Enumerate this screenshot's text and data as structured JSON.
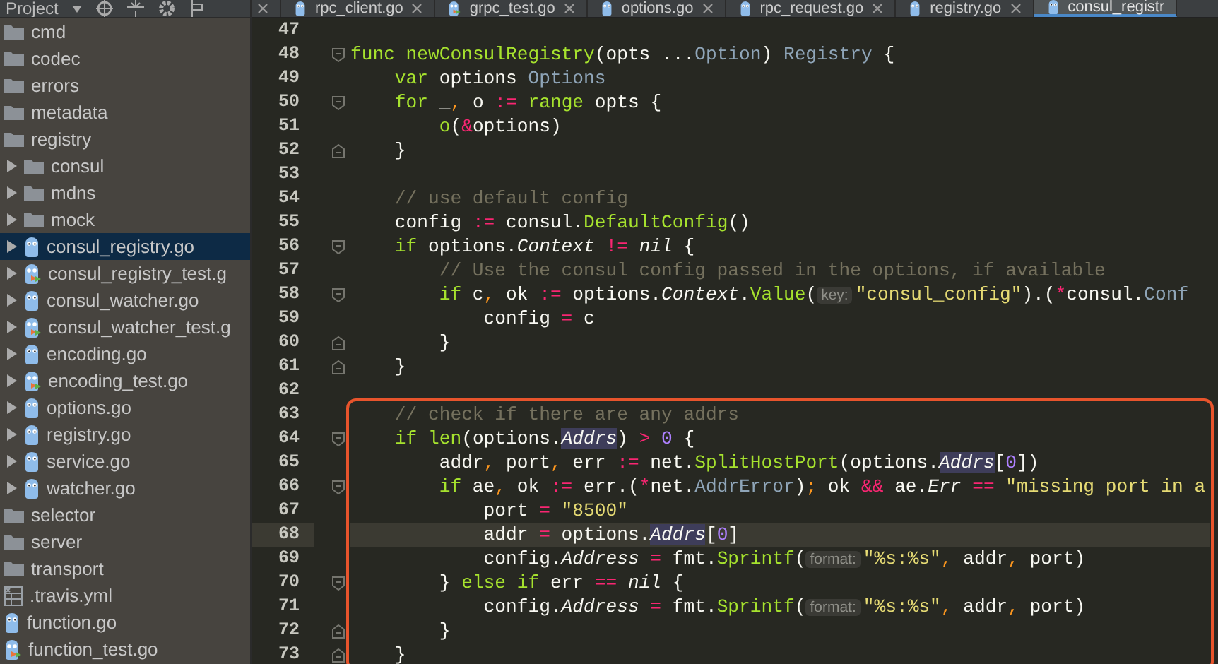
{
  "project_panel": {
    "title": "Project",
    "tree": [
      {
        "label": "cmd",
        "kind": "folder",
        "selected": false
      },
      {
        "label": "codec",
        "kind": "folder",
        "selected": false
      },
      {
        "label": "errors",
        "kind": "folder",
        "selected": false
      },
      {
        "label": "metadata",
        "kind": "folder",
        "selected": false
      },
      {
        "label": "registry",
        "kind": "folder",
        "selected": false,
        "children": [
          {
            "label": "consul",
            "kind": "folder",
            "selected": false,
            "expanded": false
          },
          {
            "label": "mdns",
            "kind": "folder",
            "selected": false,
            "expanded": false
          },
          {
            "label": "mock",
            "kind": "folder",
            "selected": false,
            "expanded": false
          },
          {
            "label": "consul_registry.go",
            "kind": "go",
            "selected": true,
            "expanded": false
          },
          {
            "label": "consul_registry_test.g",
            "kind": "gotest",
            "selected": false,
            "expanded": false
          },
          {
            "label": "consul_watcher.go",
            "kind": "go",
            "selected": false,
            "expanded": false
          },
          {
            "label": "consul_watcher_test.g",
            "kind": "gotest",
            "selected": false,
            "expanded": false
          },
          {
            "label": "encoding.go",
            "kind": "go",
            "selected": false,
            "expanded": false
          },
          {
            "label": "encoding_test.go",
            "kind": "gotest",
            "selected": false,
            "expanded": false
          },
          {
            "label": "options.go",
            "kind": "go",
            "selected": false,
            "expanded": false
          },
          {
            "label": "registry.go",
            "kind": "go",
            "selected": false,
            "expanded": false
          },
          {
            "label": "service.go",
            "kind": "go",
            "selected": false,
            "expanded": false
          },
          {
            "label": "watcher.go",
            "kind": "go",
            "selected": false,
            "expanded": false
          }
        ]
      },
      {
        "label": "selector",
        "kind": "folder",
        "selected": false
      },
      {
        "label": "server",
        "kind": "folder",
        "selected": false
      },
      {
        "label": "transport",
        "kind": "folder",
        "selected": false
      },
      {
        "label": ".travis.yml",
        "kind": "yaml",
        "selected": false
      },
      {
        "label": "function.go",
        "kind": "go",
        "selected": false
      },
      {
        "label": "function_test.go",
        "kind": "gotest",
        "selected": false
      }
    ]
  },
  "tabs": [
    {
      "label": "rpc_client.go",
      "kind": "go",
      "selected": false
    },
    {
      "label": "grpc_test.go",
      "kind": "gotest",
      "selected": false
    },
    {
      "label": "options.go",
      "kind": "go",
      "selected": false
    },
    {
      "label": "rpc_request.go",
      "kind": "go",
      "selected": false
    },
    {
      "label": "registry.go",
      "kind": "go",
      "selected": false
    },
    {
      "label": "consul_registr",
      "kind": "go",
      "selected": true
    }
  ],
  "code": {
    "lines": [
      {
        "number": "47",
        "current": false,
        "fold_start": false,
        "fold_end": false
      },
      {
        "number": "48",
        "current": false,
        "boxed": false,
        "fold_start": true,
        "fold_end": false,
        "tokens": [
          {
            "kind": "kw",
            "text": "func "
          },
          {
            "kind": "fn",
            "text": "newConsulRegistry"
          },
          {
            "kind": "plain",
            "text": "(opts ..."
          },
          {
            "kind": "type",
            "text": "Option"
          },
          {
            "kind": "plain",
            "text": ") "
          },
          {
            "kind": "type",
            "text": "Registry"
          },
          {
            "kind": "plain",
            "text": " {"
          }
        ]
      },
      {
        "number": "49",
        "current": false,
        "boxed": false,
        "fold_start": false,
        "fold_end": false,
        "tokens": [
          {
            "kind": "kw",
            "text": "    var"
          },
          {
            "kind": "plain",
            "text": " options "
          },
          {
            "kind": "type",
            "text": "Options"
          }
        ]
      },
      {
        "number": "50",
        "current": false,
        "boxed": false,
        "fold_start": true,
        "fold_end": false,
        "tokens": [
          {
            "kind": "kw",
            "text": "    for"
          },
          {
            "kind": "plain",
            "text": " _"
          },
          {
            "kind": "punc",
            "text": ","
          },
          {
            "kind": "plain",
            "text": " o "
          },
          {
            "kind": "op",
            "text": ":="
          },
          {
            "kind": "kw",
            "text": " range"
          },
          {
            "kind": "plain",
            "text": " opts {"
          }
        ]
      },
      {
        "number": "51",
        "current": false,
        "boxed": false,
        "fold_start": false,
        "fold_end": false,
        "tokens": [
          {
            "kind": "fn",
            "text": "        o"
          },
          {
            "kind": "plain",
            "text": "("
          },
          {
            "kind": "op",
            "text": "&"
          },
          {
            "kind": "plain",
            "text": "options)"
          }
        ]
      },
      {
        "number": "52",
        "current": false,
        "boxed": false,
        "fold_start": false,
        "fold_end": true,
        "tokens": [
          {
            "kind": "plain",
            "text": "    }"
          }
        ]
      },
      {
        "number": "53",
        "current": false,
        "fold_start": false,
        "fold_end": false
      },
      {
        "number": "54",
        "current": false,
        "boxed": false,
        "fold_start": false,
        "fold_end": false,
        "tokens": [
          {
            "kind": "cmt",
            "text": "    // use default config"
          }
        ]
      },
      {
        "number": "55",
        "current": false,
        "boxed": false,
        "fold_start": false,
        "fold_end": false,
        "tokens": [
          {
            "kind": "plain",
            "text": "    config "
          },
          {
            "kind": "op",
            "text": ":="
          },
          {
            "kind": "plain",
            "text": " consul."
          },
          {
            "kind": "fn",
            "text": "DefaultConfig"
          },
          {
            "kind": "plain",
            "text": "()"
          }
        ]
      },
      {
        "number": "56",
        "current": false,
        "boxed": false,
        "fold_start": true,
        "fold_end": false,
        "tokens": [
          {
            "kind": "kw",
            "text": "    if"
          },
          {
            "kind": "plain",
            "text": " options."
          },
          {
            "kind": "field",
            "text": "Context"
          },
          {
            "kind": "op",
            "text": " !="
          },
          {
            "kind": "field",
            "text": " nil"
          },
          {
            "kind": "plain",
            "text": " {"
          }
        ]
      },
      {
        "number": "57",
        "current": false,
        "boxed": false,
        "fold_start": false,
        "fold_end": false,
        "tokens": [
          {
            "kind": "cmt",
            "text": "        // Use the consul config passed in the options, if available"
          }
        ]
      },
      {
        "number": "58",
        "current": false,
        "boxed": false,
        "fold_start": true,
        "fold_end": false,
        "tokens": [
          {
            "kind": "kw",
            "text": "        if"
          },
          {
            "kind": "plain",
            "text": " c"
          },
          {
            "kind": "punc",
            "text": ","
          },
          {
            "kind": "plain",
            "text": " ok "
          },
          {
            "kind": "op",
            "text": ":="
          },
          {
            "kind": "plain",
            "text": " options."
          },
          {
            "kind": "field",
            "text": "Context"
          },
          {
            "kind": "plain",
            "text": "."
          },
          {
            "kind": "fn",
            "text": "Value"
          },
          {
            "kind": "plain",
            "text": "("
          },
          {
            "kind": "hint",
            "text": "key:"
          },
          {
            "kind": "str",
            "text": "\"consul_config\""
          },
          {
            "kind": "plain",
            "text": ").("
          },
          {
            "kind": "op",
            "text": "*"
          },
          {
            "kind": "plain",
            "text": "consul."
          },
          {
            "kind": "type",
            "text": "Conf"
          }
        ]
      },
      {
        "number": "59",
        "current": false,
        "boxed": false,
        "fold_start": false,
        "fold_end": false,
        "tokens": [
          {
            "kind": "plain",
            "text": "            config "
          },
          {
            "kind": "op",
            "text": "="
          },
          {
            "kind": "plain",
            "text": " c"
          }
        ]
      },
      {
        "number": "60",
        "current": false,
        "boxed": false,
        "fold_start": false,
        "fold_end": true,
        "tokens": [
          {
            "kind": "plain",
            "text": "        }"
          }
        ]
      },
      {
        "number": "61",
        "current": false,
        "boxed": false,
        "fold_start": false,
        "fold_end": true,
        "tokens": [
          {
            "kind": "plain",
            "text": "    }"
          }
        ]
      },
      {
        "number": "62",
        "current": false,
        "fold_start": false,
        "fold_end": false
      },
      {
        "number": "63",
        "current": false,
        "boxed": true,
        "fold_start": false,
        "fold_end": false,
        "tokens": [
          {
            "kind": "cmt",
            "text": "    // check if there are any addrs"
          }
        ]
      },
      {
        "number": "64",
        "current": false,
        "boxed": true,
        "fold_start": true,
        "fold_end": false,
        "tokens": [
          {
            "kind": "kw",
            "text": "    if"
          },
          {
            "kind": "fn",
            "text": " len"
          },
          {
            "kind": "plain",
            "text": "(options."
          },
          {
            "kind": "mark",
            "text": "Addrs"
          },
          {
            "kind": "plain",
            "text": ") "
          },
          {
            "kind": "op",
            "text": ">"
          },
          {
            "kind": "num",
            "text": " 0"
          },
          {
            "kind": "plain",
            "text": " {"
          }
        ]
      },
      {
        "number": "65",
        "current": false,
        "boxed": true,
        "fold_start": false,
        "fold_end": false,
        "tokens": [
          {
            "kind": "plain",
            "text": "        addr"
          },
          {
            "kind": "punc",
            "text": ","
          },
          {
            "kind": "plain",
            "text": " port"
          },
          {
            "kind": "punc",
            "text": ","
          },
          {
            "kind": "plain",
            "text": " err "
          },
          {
            "kind": "op",
            "text": ":="
          },
          {
            "kind": "plain",
            "text": " net."
          },
          {
            "kind": "fn",
            "text": "SplitHostPort"
          },
          {
            "kind": "plain",
            "text": "(options."
          },
          {
            "kind": "mark",
            "text": "Addrs"
          },
          {
            "kind": "plain",
            "text": "["
          },
          {
            "kind": "num",
            "text": "0"
          },
          {
            "kind": "plain",
            "text": "])"
          }
        ]
      },
      {
        "number": "66",
        "current": false,
        "boxed": true,
        "fold_start": true,
        "fold_end": false,
        "tokens": [
          {
            "kind": "kw",
            "text": "        if"
          },
          {
            "kind": "plain",
            "text": " ae"
          },
          {
            "kind": "punc",
            "text": ","
          },
          {
            "kind": "plain",
            "text": " ok "
          },
          {
            "kind": "op",
            "text": ":="
          },
          {
            "kind": "plain",
            "text": " err.("
          },
          {
            "kind": "op",
            "text": "*"
          },
          {
            "kind": "plain",
            "text": "net."
          },
          {
            "kind": "type",
            "text": "AddrError"
          },
          {
            "kind": "plain",
            "text": ")"
          },
          {
            "kind": "punc",
            "text": ";"
          },
          {
            "kind": "plain",
            "text": " ok "
          },
          {
            "kind": "op",
            "text": "&&"
          },
          {
            "kind": "plain",
            "text": " ae."
          },
          {
            "kind": "field",
            "text": "Err"
          },
          {
            "kind": "op",
            "text": " =="
          },
          {
            "kind": "str",
            "text": " \"missing port in a"
          }
        ]
      },
      {
        "number": "67",
        "current": false,
        "boxed": true,
        "fold_start": false,
        "fold_end": false,
        "tokens": [
          {
            "kind": "plain",
            "text": "            port "
          },
          {
            "kind": "op",
            "text": "="
          },
          {
            "kind": "str",
            "text": " \"8500\""
          }
        ]
      },
      {
        "number": "68",
        "current": true,
        "boxed": true,
        "fold_start": false,
        "fold_end": false,
        "tokens": [
          {
            "kind": "plain",
            "text": "            addr "
          },
          {
            "kind": "op",
            "text": "="
          },
          {
            "kind": "plain",
            "text": " options."
          },
          {
            "kind": "mark",
            "text": "Addrs"
          },
          {
            "kind": "plain",
            "text": "["
          },
          {
            "kind": "num",
            "text": "0"
          },
          {
            "kind": "plain",
            "text": "]"
          }
        ]
      },
      {
        "number": "69",
        "current": false,
        "boxed": true,
        "fold_start": false,
        "fold_end": false,
        "tokens": [
          {
            "kind": "plain",
            "text": "            config."
          },
          {
            "kind": "field",
            "text": "Address"
          },
          {
            "kind": "op",
            "text": " ="
          },
          {
            "kind": "plain",
            "text": " fmt."
          },
          {
            "kind": "fn",
            "text": "Sprintf"
          },
          {
            "kind": "plain",
            "text": "("
          },
          {
            "kind": "hint",
            "text": "format:"
          },
          {
            "kind": "str",
            "text": "\"%s:%s\""
          },
          {
            "kind": "punc",
            "text": ","
          },
          {
            "kind": "plain",
            "text": " addr"
          },
          {
            "kind": "punc",
            "text": ","
          },
          {
            "kind": "plain",
            "text": " port)"
          }
        ]
      },
      {
        "number": "70",
        "current": false,
        "boxed": true,
        "fold_start": true,
        "fold_end": false,
        "tokens": [
          {
            "kind": "plain",
            "text": "        } "
          },
          {
            "kind": "kw",
            "text": "else if"
          },
          {
            "kind": "plain",
            "text": " err "
          },
          {
            "kind": "op",
            "text": "=="
          },
          {
            "kind": "field",
            "text": " nil"
          },
          {
            "kind": "plain",
            "text": " {"
          }
        ]
      },
      {
        "number": "71",
        "current": false,
        "boxed": true,
        "fold_start": false,
        "fold_end": false,
        "tokens": [
          {
            "kind": "plain",
            "text": "            config."
          },
          {
            "kind": "field",
            "text": "Address"
          },
          {
            "kind": "op",
            "text": " ="
          },
          {
            "kind": "plain",
            "text": " fmt."
          },
          {
            "kind": "fn",
            "text": "Sprintf"
          },
          {
            "kind": "plain",
            "text": "("
          },
          {
            "kind": "hint",
            "text": "format:"
          },
          {
            "kind": "str",
            "text": "\"%s:%s\""
          },
          {
            "kind": "punc",
            "text": ","
          },
          {
            "kind": "plain",
            "text": " addr"
          },
          {
            "kind": "punc",
            "text": ","
          },
          {
            "kind": "plain",
            "text": " port)"
          }
        ]
      },
      {
        "number": "72",
        "current": false,
        "boxed": true,
        "fold_start": false,
        "fold_end": true,
        "tokens": [
          {
            "kind": "plain",
            "text": "        }"
          }
        ]
      },
      {
        "number": "73",
        "current": false,
        "boxed": true,
        "fold_start": false,
        "fold_end": true,
        "tokens": [
          {
            "kind": "plain",
            "text": "    }"
          }
        ]
      }
    ]
  }
}
